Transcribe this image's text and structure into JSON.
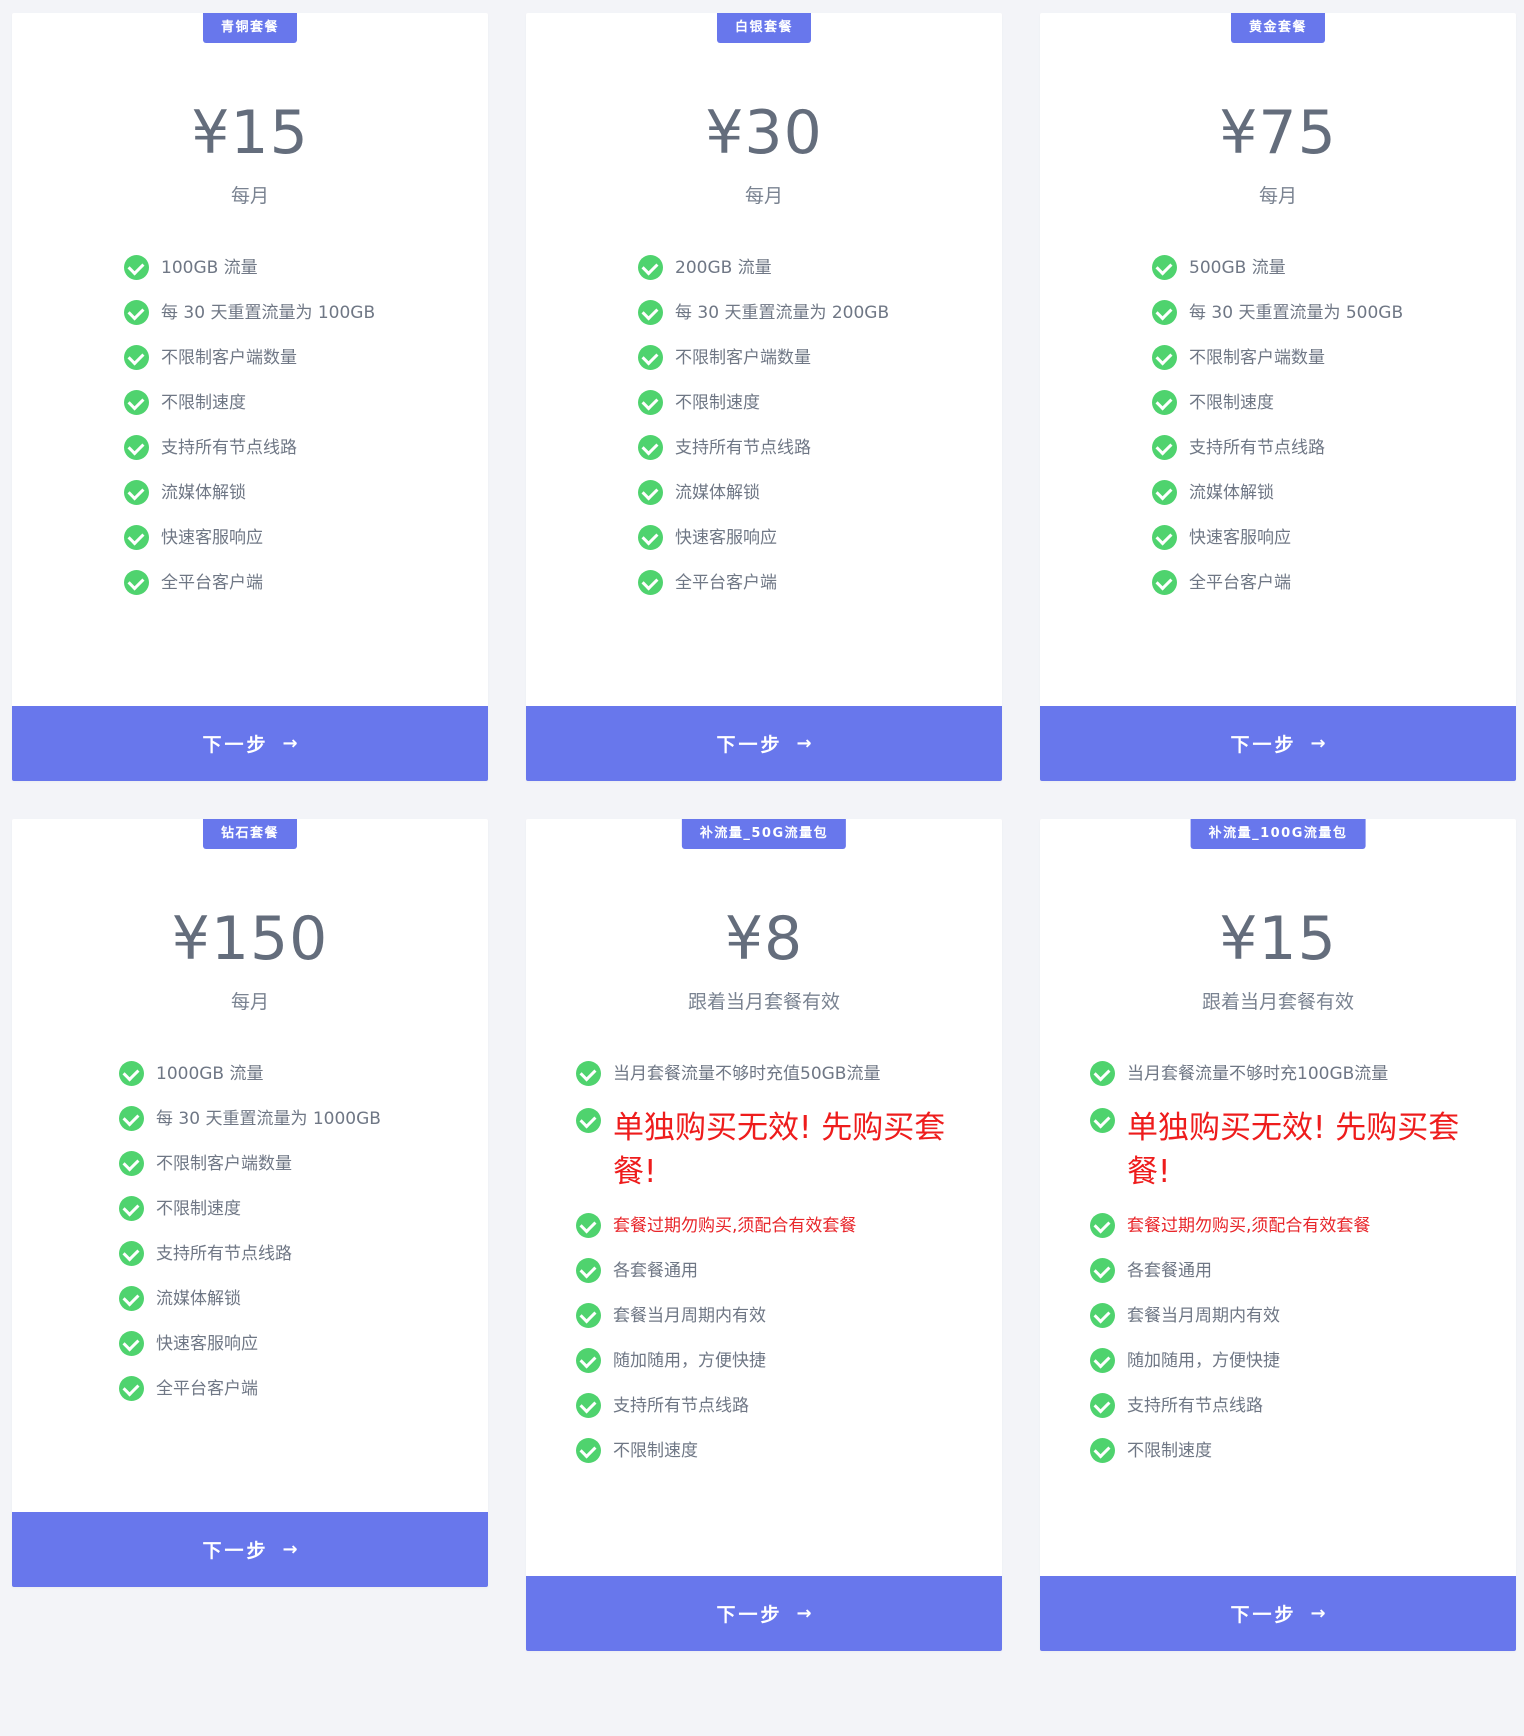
{
  "plans": [
    {
      "badge": "青铜套餐",
      "price": "¥15",
      "period": "每月",
      "features": [
        "100GB 流量",
        "每 30 天重置流量为 100GB",
        "不限制客户端数量",
        "不限制速度",
        "支持所有节点线路",
        "流媒体解锁",
        "快速客服响应",
        "全平台客户端"
      ],
      "button": "下一步"
    },
    {
      "badge": "白银套餐",
      "price": "¥30",
      "period": "每月",
      "features": [
        "200GB 流量",
        "每 30 天重置流量为 200GB",
        "不限制客户端数量",
        "不限制速度",
        "支持所有节点线路",
        "流媒体解锁",
        "快速客服响应",
        "全平台客户端"
      ],
      "button": "下一步"
    },
    {
      "badge": "黄金套餐",
      "price": "¥75",
      "period": "每月",
      "features": [
        "500GB 流量",
        "每 30 天重置流量为 500GB",
        "不限制客户端数量",
        "不限制速度",
        "支持所有节点线路",
        "流媒体解锁",
        "快速客服响应",
        "全平台客户端"
      ],
      "button": "下一步"
    },
    {
      "badge": "钻石套餐",
      "price": "¥150",
      "period": "每月",
      "features": [
        "1000GB 流量",
        "每 30 天重置流量为 1000GB",
        "不限制客户端数量",
        "不限制速度",
        "支持所有节点线路",
        "流媒体解锁",
        "快速客服响应",
        "全平台客户端"
      ],
      "button": "下一步"
    },
    {
      "badge": "补流量_50G流量包",
      "price": "¥8",
      "period": "跟着当月套餐有效",
      "features": [
        "当月套餐流量不够时充值50GB流量",
        "单独购买无效! 先购买套餐!",
        "套餐过期勿购买,须配合有效套餐",
        "各套餐通用",
        "套餐当月周期内有效",
        "随加随用，方便快捷",
        "支持所有节点线路",
        "不限制速度"
      ],
      "button": "下一步"
    },
    {
      "badge": "补流量_100G流量包",
      "price": "¥15",
      "period": "跟着当月套餐有效",
      "features": [
        "当月套餐流量不够时充100GB流量",
        "单独购买无效! 先购买套餐!",
        "套餐过期勿购买,须配合有效套餐",
        "各套餐通用",
        "套餐当月周期内有效",
        "随加随用，方便快捷",
        "支持所有节点线路",
        "不限制速度"
      ],
      "button": "下一步"
    }
  ],
  "colors": {
    "accent": "#6877ec",
    "check": "#4fd36e",
    "warning": "#ee1c1c",
    "text": "#6f7785"
  },
  "icons": {
    "feature": "check-circle-icon",
    "button": "arrow-right-icon"
  }
}
